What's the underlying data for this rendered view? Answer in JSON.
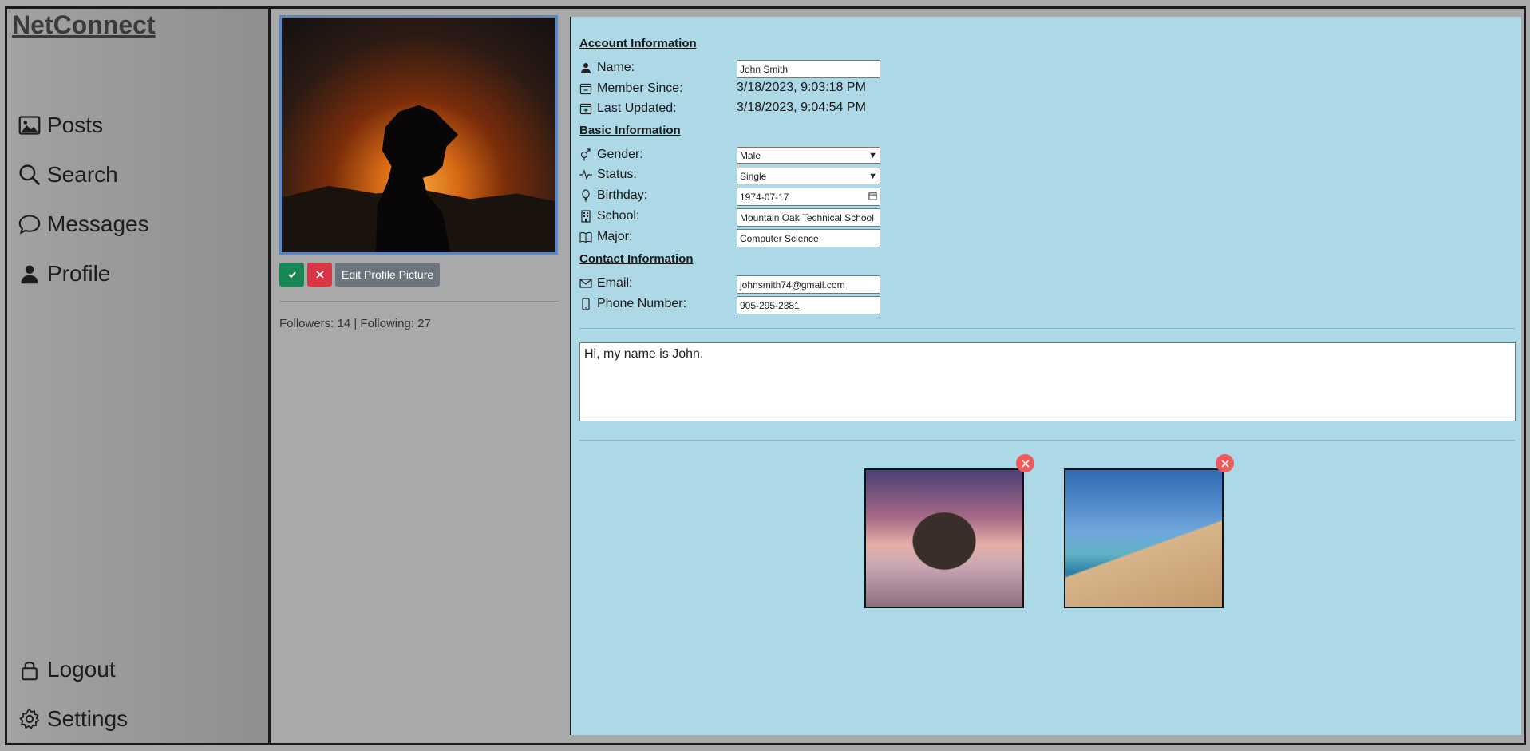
{
  "app": {
    "brand": "NetConnect"
  },
  "sidebar": {
    "items": [
      {
        "label": "Posts",
        "icon": "image-icon"
      },
      {
        "label": "Search",
        "icon": "search-icon"
      },
      {
        "label": "Messages",
        "icon": "chat-bubble-icon"
      },
      {
        "label": "Profile",
        "icon": "person-icon"
      }
    ],
    "bottom": [
      {
        "label": "Logout",
        "icon": "lock-icon"
      },
      {
        "label": "Settings",
        "icon": "gear-icon"
      }
    ]
  },
  "profile": {
    "edit_picture_label": "Edit Profile Picture",
    "follow_text": "Followers: 14 | Following: 27"
  },
  "account": {
    "title": "Account Information",
    "name_label": "Name:",
    "name_value": "John Smith",
    "member_since_label": "Member Since:",
    "member_since_value": "3/18/2023, 9:03:18 PM",
    "last_updated_label": "Last Updated:",
    "last_updated_value": "3/18/2023, 9:04:54 PM"
  },
  "basic": {
    "title": "Basic Information",
    "gender_label": "Gender:",
    "gender_value": "Male",
    "status_label": "Status:",
    "status_value": "Single",
    "birthday_label": "Birthday:",
    "birthday_value": "1974-07-17",
    "school_label": "School:",
    "school_value": "Mountain Oak Technical  School",
    "major_label": "Major:",
    "major_value": "Computer Science"
  },
  "contact": {
    "title": "Contact Information",
    "email_label": "Email:",
    "email_value": "johnsmith74@gmail.com",
    "phone_label": "Phone Number:",
    "phone_value": "905-295-2381"
  },
  "bio": {
    "text": "Hi, my name is John."
  },
  "colors": {
    "panel_bg": "#add8e6",
    "sidebar_bg": "#9a9a9a",
    "confirm": "#198754",
    "cancel": "#dc3545",
    "edit_btn": "#6c757d",
    "remove_badge": "#f25a5a"
  }
}
